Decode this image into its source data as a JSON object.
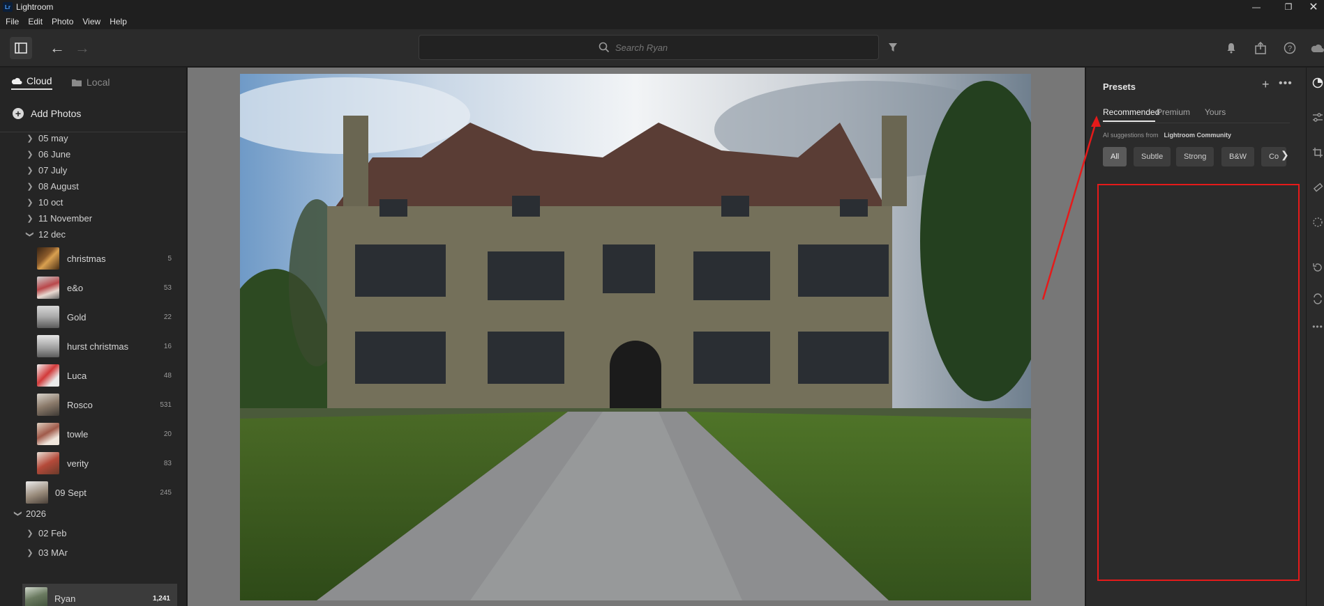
{
  "window": {
    "title": "Lightroom",
    "logo_text": "Lr"
  },
  "menu": [
    "File",
    "Edit",
    "Photo",
    "View",
    "Help"
  ],
  "toolbar": {
    "search_placeholder": "Search Ryan"
  },
  "left_panel": {
    "tabs": {
      "cloud": "Cloud",
      "local": "Local"
    },
    "add_photos": "Add Photos",
    "tree": [
      {
        "label": "05 may",
        "expanded": false
      },
      {
        "label": "06 June",
        "expanded": false
      },
      {
        "label": "07 July",
        "expanded": false
      },
      {
        "label": "08 August",
        "expanded": false
      },
      {
        "label": "10 oct",
        "expanded": false
      },
      {
        "label": "11 November",
        "expanded": false
      },
      {
        "label": "12 dec",
        "expanded": true
      }
    ],
    "albums": [
      {
        "label": "christmas",
        "count": "5"
      },
      {
        "label": "e&o",
        "count": "53"
      },
      {
        "label": "Gold",
        "count": "22"
      },
      {
        "label": "hurst christmas",
        "count": "16"
      },
      {
        "label": "Luca",
        "count": "48"
      },
      {
        "label": "Rosco",
        "count": "531"
      },
      {
        "label": "towle",
        "count": "20"
      },
      {
        "label": "verity",
        "count": "83"
      }
    ],
    "sept_album": {
      "label": "09 Sept",
      "count": "245"
    },
    "year": {
      "label": "2026",
      "expanded": true
    },
    "year_items": [
      {
        "label": "02 Feb",
        "expanded": false
      },
      {
        "label": "03 MAr",
        "expanded": false
      }
    ],
    "selected_album": {
      "label": "Ryan",
      "count": "1,241"
    }
  },
  "right_panel": {
    "title": "Presets",
    "tabs": [
      "Recommended",
      "Premium",
      "Yours"
    ],
    "ai_prefix": "AI suggestions from",
    "ai_source": "Lightroom Community",
    "chips": [
      "All",
      "Subtle",
      "Strong",
      "B&W",
      "Co"
    ]
  },
  "colors": {
    "annotation": "#e51a1a",
    "accent": "#e6e6e6"
  }
}
